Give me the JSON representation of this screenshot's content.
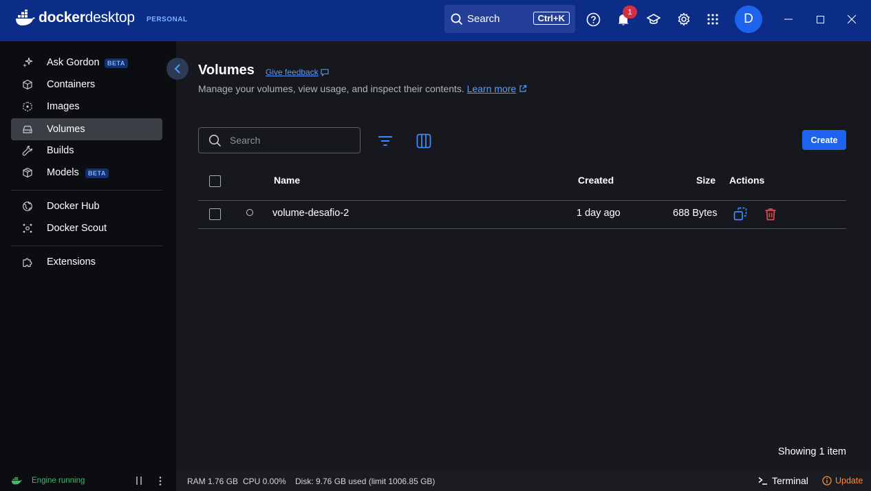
{
  "app": {
    "logo_docker": "docker",
    "logo_desktop": "desktop",
    "edition": "PERSONAL",
    "search_label": "Search",
    "search_shortcut": "Ctrl+K",
    "notification_count": "1",
    "avatar_initial": "D"
  },
  "sidebar": {
    "items": [
      {
        "label": "Ask Gordon",
        "icon": "sparkle-icon",
        "badge": "BETA"
      },
      {
        "label": "Containers",
        "icon": "container-icon"
      },
      {
        "label": "Images",
        "icon": "image-icon"
      },
      {
        "label": "Volumes",
        "icon": "volume-icon",
        "active": true
      },
      {
        "label": "Builds",
        "icon": "wrench-icon"
      },
      {
        "label": "Models",
        "icon": "cube-icon",
        "badge": "BETA"
      },
      {
        "label": "Docker Hub",
        "icon": "globe-icon"
      },
      {
        "label": "Docker Scout",
        "icon": "scout-icon"
      },
      {
        "label": "Extensions",
        "icon": "puzzle-icon"
      }
    ]
  },
  "page": {
    "title": "Volumes",
    "feedback": "Give feedback",
    "subtitle": "Manage your volumes, view usage, and inspect their contents.",
    "learn_more": "Learn more",
    "search_placeholder": "Search",
    "create_label": "Create",
    "showing": "Showing 1 item"
  },
  "table": {
    "columns": {
      "name": "Name",
      "created": "Created",
      "size": "Size",
      "actions": "Actions"
    },
    "rows": [
      {
        "name": "volume-desafio-2",
        "created": "1 day ago",
        "size": "688 Bytes"
      }
    ]
  },
  "footer": {
    "engine": "Engine running",
    "ram": "RAM 1.76 GB",
    "cpu": "CPU 0.00%",
    "disk": "Disk: 9.76 GB used (limit 1006.85 GB)",
    "terminal": "Terminal",
    "update": "Update"
  },
  "colors": {
    "titlebar": "#0b2d87",
    "accent": "#1d63ed",
    "link": "#5b9bff",
    "danger": "#e5484d",
    "engine_ok": "#3fbc6b",
    "update": "#ff8a3a"
  }
}
